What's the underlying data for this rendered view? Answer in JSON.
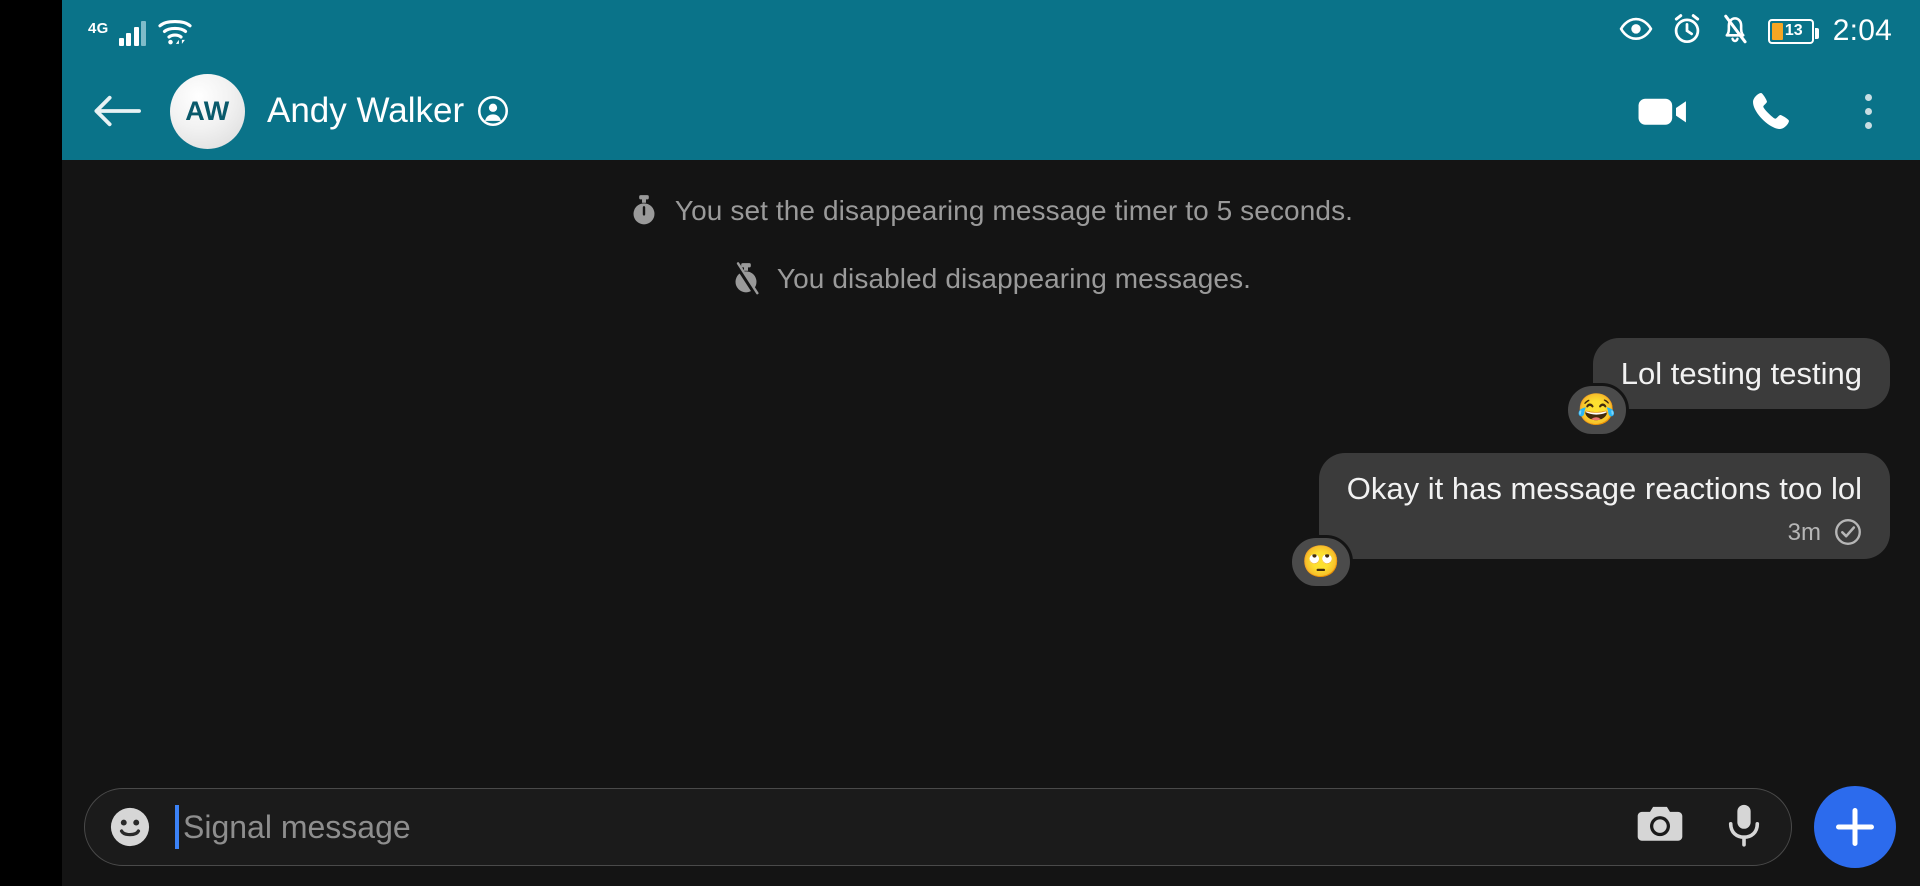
{
  "status_bar": {
    "network_label": "4G",
    "icons": [
      "signal-bars-icon",
      "wifi-icon",
      "eye-icon",
      "alarm-clock-icon",
      "bell-off-icon"
    ],
    "battery_percent": "13",
    "time": "2:04"
  },
  "toolbar": {
    "back_label": "back-arrow",
    "avatar_initials": "AW",
    "contact_name": "Andy Walker",
    "verified_icon": "person-circle-icon",
    "actions": [
      "video-call",
      "voice-call",
      "overflow-menu"
    ]
  },
  "conversation": {
    "system_messages": [
      {
        "icon": "timer-icon",
        "text": "You set the disappearing message timer to 5 seconds."
      },
      {
        "icon": "timer-off-icon",
        "text": "You disabled disappearing messages."
      }
    ],
    "messages": [
      {
        "text": "Lol testing testing",
        "direction": "outgoing",
        "reaction": "😂",
        "timestamp": "",
        "status": ""
      },
      {
        "text": "Okay it has message reactions too lol",
        "direction": "outgoing",
        "reaction": "🙄",
        "timestamp": "3m",
        "status": "delivered-check-icon"
      }
    ]
  },
  "compose": {
    "emoji_button": "emoji-smiley-icon",
    "placeholder": "Signal message",
    "value": "",
    "camera_button": "camera-icon",
    "mic_button": "microphone-icon",
    "attach_button": "plus-icon"
  },
  "colors": {
    "header_teal": "#0A7389",
    "app_background": "#141414",
    "bubble_gray": "#3B3B3B",
    "reaction_gray": "#4B4B4B",
    "accent_blue": "#2C6BED",
    "caret_blue": "#3B82F6",
    "battery_orange": "#F5A623",
    "system_text": "#9A9A9A"
  }
}
